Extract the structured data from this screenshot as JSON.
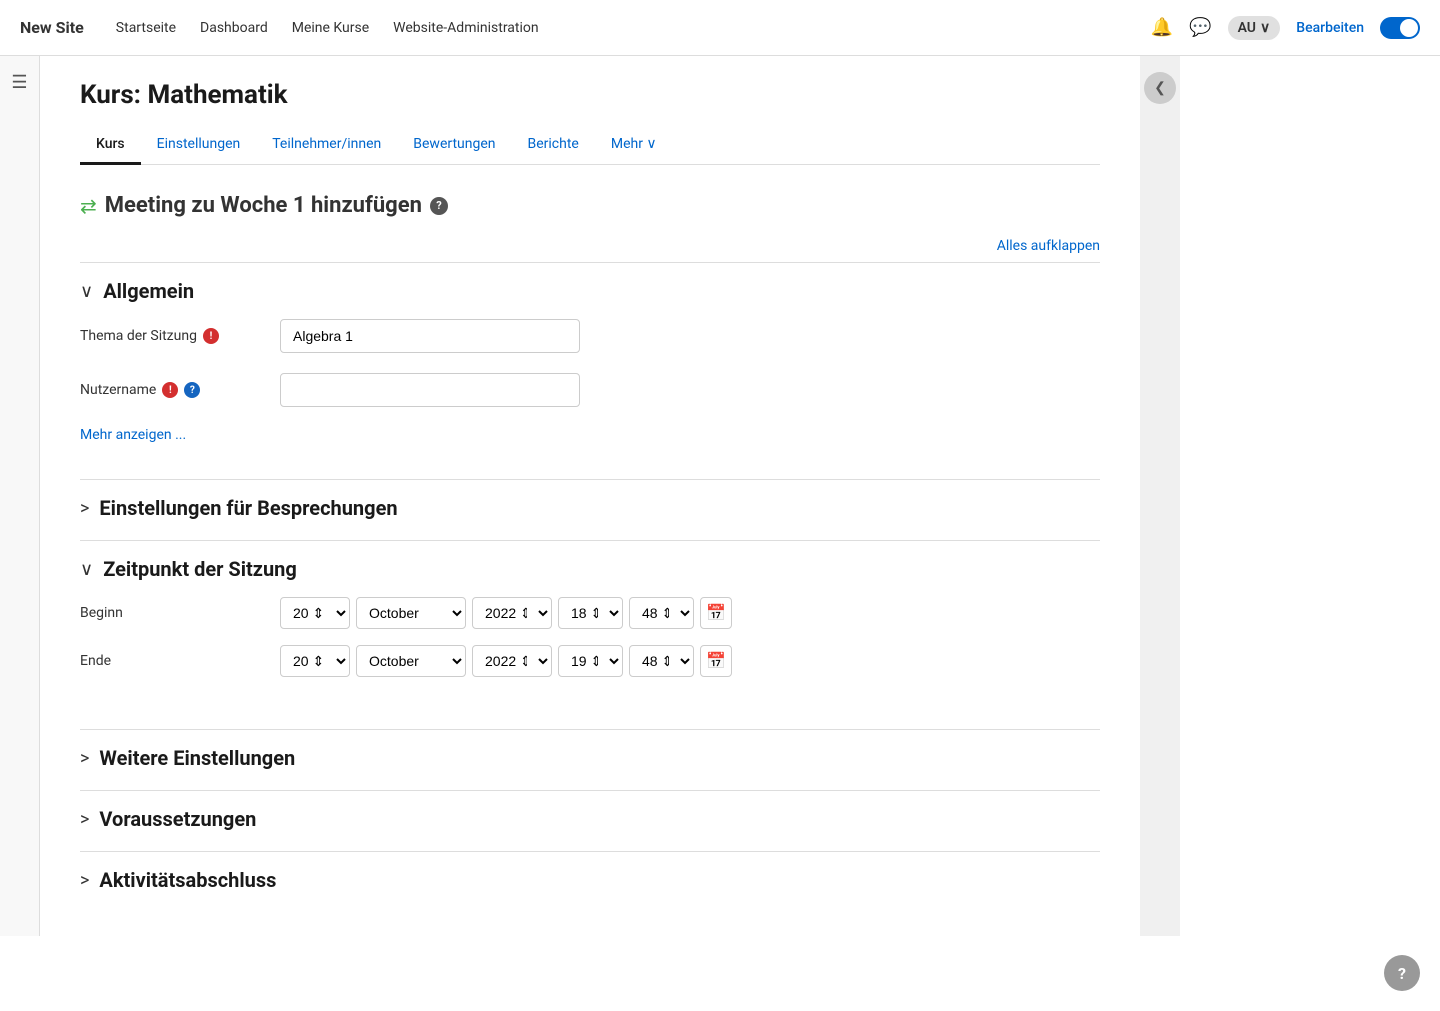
{
  "site": {
    "name": "New Site"
  },
  "nav": {
    "links": [
      "Startseite",
      "Dashboard",
      "Meine Kurse",
      "Website-Administration"
    ],
    "user_initials": "AU",
    "bearbeiten": "Bearbeiten"
  },
  "page": {
    "title": "Kurs: Mathematik"
  },
  "tabs": [
    {
      "id": "kurs",
      "label": "Kurs",
      "active": true
    },
    {
      "id": "einstellungen",
      "label": "Einstellungen",
      "active": false
    },
    {
      "id": "teilnehmer",
      "label": "Teilnehmer/innen",
      "active": false
    },
    {
      "id": "bewertungen",
      "label": "Bewertungen",
      "active": false
    },
    {
      "id": "berichte",
      "label": "Berichte",
      "active": false
    },
    {
      "id": "mehr",
      "label": "Mehr ∨",
      "active": false
    }
  ],
  "form": {
    "page_title": "Meeting zu Woche 1 hinzufügen",
    "alles_aufklappen": "Alles aufklappen",
    "sections": {
      "allgemein": {
        "title": "Allgemein",
        "expanded": true,
        "chevron": "∨",
        "fields": {
          "thema_label": "Thema der Sitzung",
          "thema_value": "Algebra 1",
          "thema_placeholder": "",
          "nutzername_label": "Nutzername",
          "nutzername_value": "",
          "nutzername_placeholder": ""
        },
        "mehr_anzeigen": "Mehr anzeigen ..."
      },
      "besprechungen": {
        "title": "Einstellungen für Besprechungen",
        "expanded": false,
        "chevron": ">"
      },
      "zeitpunkt": {
        "title": "Zeitpunkt der Sitzung",
        "expanded": true,
        "chevron": "∨",
        "beginn_label": "Beginn",
        "ende_label": "Ende",
        "beginn": {
          "day": "20",
          "month": "October",
          "year": "2022",
          "hour": "18",
          "min": "48"
        },
        "ende": {
          "day": "20",
          "month": "October",
          "year": "2022",
          "hour": "19",
          "min": "48"
        }
      },
      "weitere": {
        "title": "Weitere Einstellungen",
        "expanded": false,
        "chevron": ">"
      },
      "voraussetzungen": {
        "title": "Voraussetzungen",
        "expanded": false,
        "chevron": ">"
      },
      "aktivitaet": {
        "title": "Aktivitätsabschluss",
        "expanded": false,
        "chevron": ">"
      }
    }
  },
  "icons": {
    "menu": "☰",
    "bell": "🔔",
    "chat": "💬",
    "chevron_left": "❮",
    "chevron_down": "∨",
    "calendar": "📅",
    "question": "?",
    "exclamation": "!",
    "info": "?"
  }
}
